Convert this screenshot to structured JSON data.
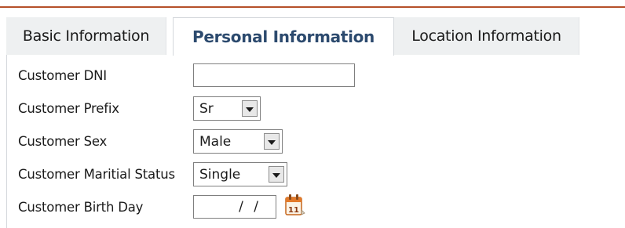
{
  "tabs": {
    "basic": "Basic Information",
    "personal": "Personal Information",
    "location": "Location Information",
    "active": "personal"
  },
  "form": {
    "dni": {
      "label": "Customer DNI",
      "value": ""
    },
    "prefix": {
      "label": "Customer Prefix",
      "value": "Sr"
    },
    "sex": {
      "label": "Customer Sex",
      "value": "Male"
    },
    "marital": {
      "label": "Customer Maritial Status",
      "value": "Single"
    },
    "birthday": {
      "label": "Customer Birth Day",
      "value": "/ /",
      "calendar_day": "11"
    }
  },
  "colors": {
    "accent_rule": "#b5502a",
    "active_tab_text": "#2c4a6e",
    "inactive_tab_bg": "#eef0f1"
  },
  "icons": {
    "calendar": "calendar-icon",
    "dropdown": "chevron-down-icon"
  }
}
